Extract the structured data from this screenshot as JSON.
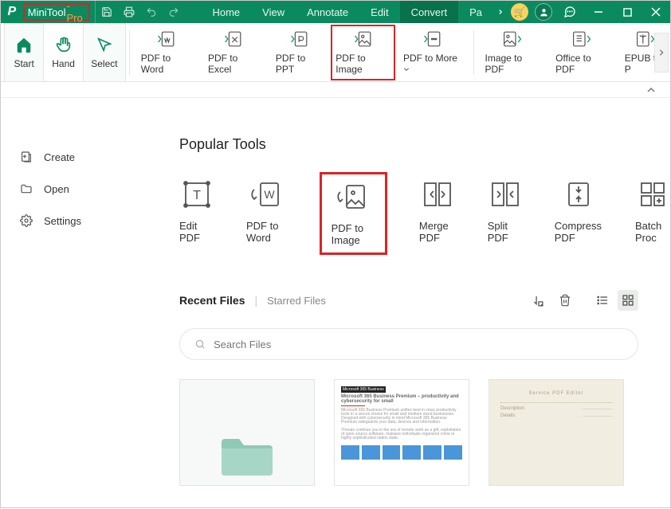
{
  "brand": {
    "name1": "MiniTool",
    "name2": "-Pro"
  },
  "menu": {
    "home": "Home",
    "view": "View",
    "annotate": "Annotate",
    "edit": "Edit",
    "convert": "Convert",
    "page": "Pa"
  },
  "ribbon": {
    "start": "Start",
    "hand": "Hand",
    "select": "Select",
    "pdf_to_word": "PDF to Word",
    "pdf_to_excel": "PDF to Excel",
    "pdf_to_ppt": "PDF to PPT",
    "pdf_to_image": "PDF to Image",
    "pdf_to_more": "PDF to More",
    "image_to_pdf": "Image to PDF",
    "office_to_pdf": "Office to PDF",
    "epub_to_pdf": "EPUB to P"
  },
  "sidebar": {
    "create": "Create",
    "open": "Open",
    "settings": "Settings"
  },
  "tools": {
    "title": "Popular Tools",
    "edit_pdf": "Edit PDF",
    "pdf_to_word": "PDF to Word",
    "pdf_to_image": "PDF to Image",
    "merge_pdf": "Merge PDF",
    "split_pdf": "Split PDF",
    "compress_pdf": "Compress PDF",
    "batch": "Batch Proc"
  },
  "recent": {
    "tab1": "Recent Files",
    "tab2": "Starred Files"
  },
  "search": {
    "placeholder": "Search Files"
  },
  "doc_preview": {
    "headline": "Microsoft 365 Business Premium – productivity and cybersecurity for small"
  },
  "beige_title": "Service PDF Editor",
  "beige_c1": "Description",
  "beige_c2": "Details"
}
